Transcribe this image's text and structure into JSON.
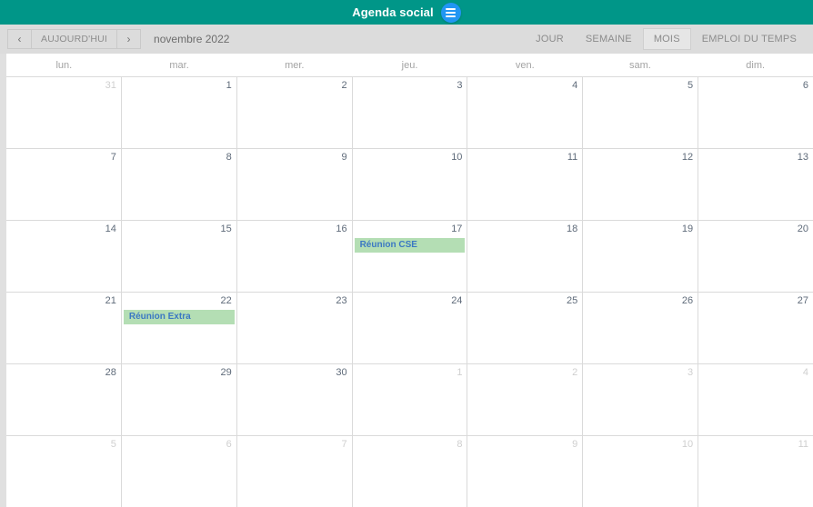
{
  "titlebar": {
    "title": "Agenda social",
    "menu_icon": "hamburger-menu-icon",
    "bg_color": "#009688",
    "fab_color": "#2196f3"
  },
  "toolbar": {
    "prev_label": "‹",
    "today_label": "AUJOURD'HUI",
    "next_label": "›",
    "period_label": "novembre 2022",
    "views": [
      {
        "label": "JOUR",
        "active": false
      },
      {
        "label": "SEMAINE",
        "active": false
      },
      {
        "label": "MOIS",
        "active": true
      },
      {
        "label": "EMPLOI DU TEMPS",
        "active": false
      }
    ]
  },
  "calendar": {
    "day_headers": [
      "lun.",
      "mar.",
      "mer.",
      "jeu.",
      "ven.",
      "sam.",
      "dim."
    ],
    "event_bg_color": "#b4deb4",
    "event_text_color": "#3b78c3",
    "weeks": [
      [
        {
          "num": "31",
          "other_month": true,
          "events": []
        },
        {
          "num": "1",
          "other_month": false,
          "events": []
        },
        {
          "num": "2",
          "other_month": false,
          "events": []
        },
        {
          "num": "3",
          "other_month": false,
          "events": []
        },
        {
          "num": "4",
          "other_month": false,
          "events": []
        },
        {
          "num": "5",
          "other_month": false,
          "events": []
        },
        {
          "num": "6",
          "other_month": false,
          "events": []
        }
      ],
      [
        {
          "num": "7",
          "other_month": false,
          "events": []
        },
        {
          "num": "8",
          "other_month": false,
          "events": []
        },
        {
          "num": "9",
          "other_month": false,
          "events": []
        },
        {
          "num": "10",
          "other_month": false,
          "events": []
        },
        {
          "num": "11",
          "other_month": false,
          "events": []
        },
        {
          "num": "12",
          "other_month": false,
          "events": []
        },
        {
          "num": "13",
          "other_month": false,
          "events": []
        }
      ],
      [
        {
          "num": "14",
          "other_month": false,
          "events": []
        },
        {
          "num": "15",
          "other_month": false,
          "events": []
        },
        {
          "num": "16",
          "other_month": false,
          "events": []
        },
        {
          "num": "17",
          "other_month": false,
          "events": [
            "Réunion CSE"
          ]
        },
        {
          "num": "18",
          "other_month": false,
          "events": []
        },
        {
          "num": "19",
          "other_month": false,
          "events": []
        },
        {
          "num": "20",
          "other_month": false,
          "events": []
        }
      ],
      [
        {
          "num": "21",
          "other_month": false,
          "events": []
        },
        {
          "num": "22",
          "other_month": false,
          "events": [
            "Réunion Extra"
          ]
        },
        {
          "num": "23",
          "other_month": false,
          "events": []
        },
        {
          "num": "24",
          "other_month": false,
          "events": []
        },
        {
          "num": "25",
          "other_month": false,
          "events": []
        },
        {
          "num": "26",
          "other_month": false,
          "events": []
        },
        {
          "num": "27",
          "other_month": false,
          "events": []
        }
      ],
      [
        {
          "num": "28",
          "other_month": false,
          "events": []
        },
        {
          "num": "29",
          "other_month": false,
          "events": []
        },
        {
          "num": "30",
          "other_month": false,
          "events": []
        },
        {
          "num": "1",
          "other_month": true,
          "events": []
        },
        {
          "num": "2",
          "other_month": true,
          "events": []
        },
        {
          "num": "3",
          "other_month": true,
          "events": []
        },
        {
          "num": "4",
          "other_month": true,
          "events": []
        }
      ],
      [
        {
          "num": "5",
          "other_month": true,
          "events": []
        },
        {
          "num": "6",
          "other_month": true,
          "events": []
        },
        {
          "num": "7",
          "other_month": true,
          "events": []
        },
        {
          "num": "8",
          "other_month": true,
          "events": []
        },
        {
          "num": "9",
          "other_month": true,
          "events": []
        },
        {
          "num": "10",
          "other_month": true,
          "events": []
        },
        {
          "num": "11",
          "other_month": true,
          "events": []
        }
      ]
    ]
  }
}
